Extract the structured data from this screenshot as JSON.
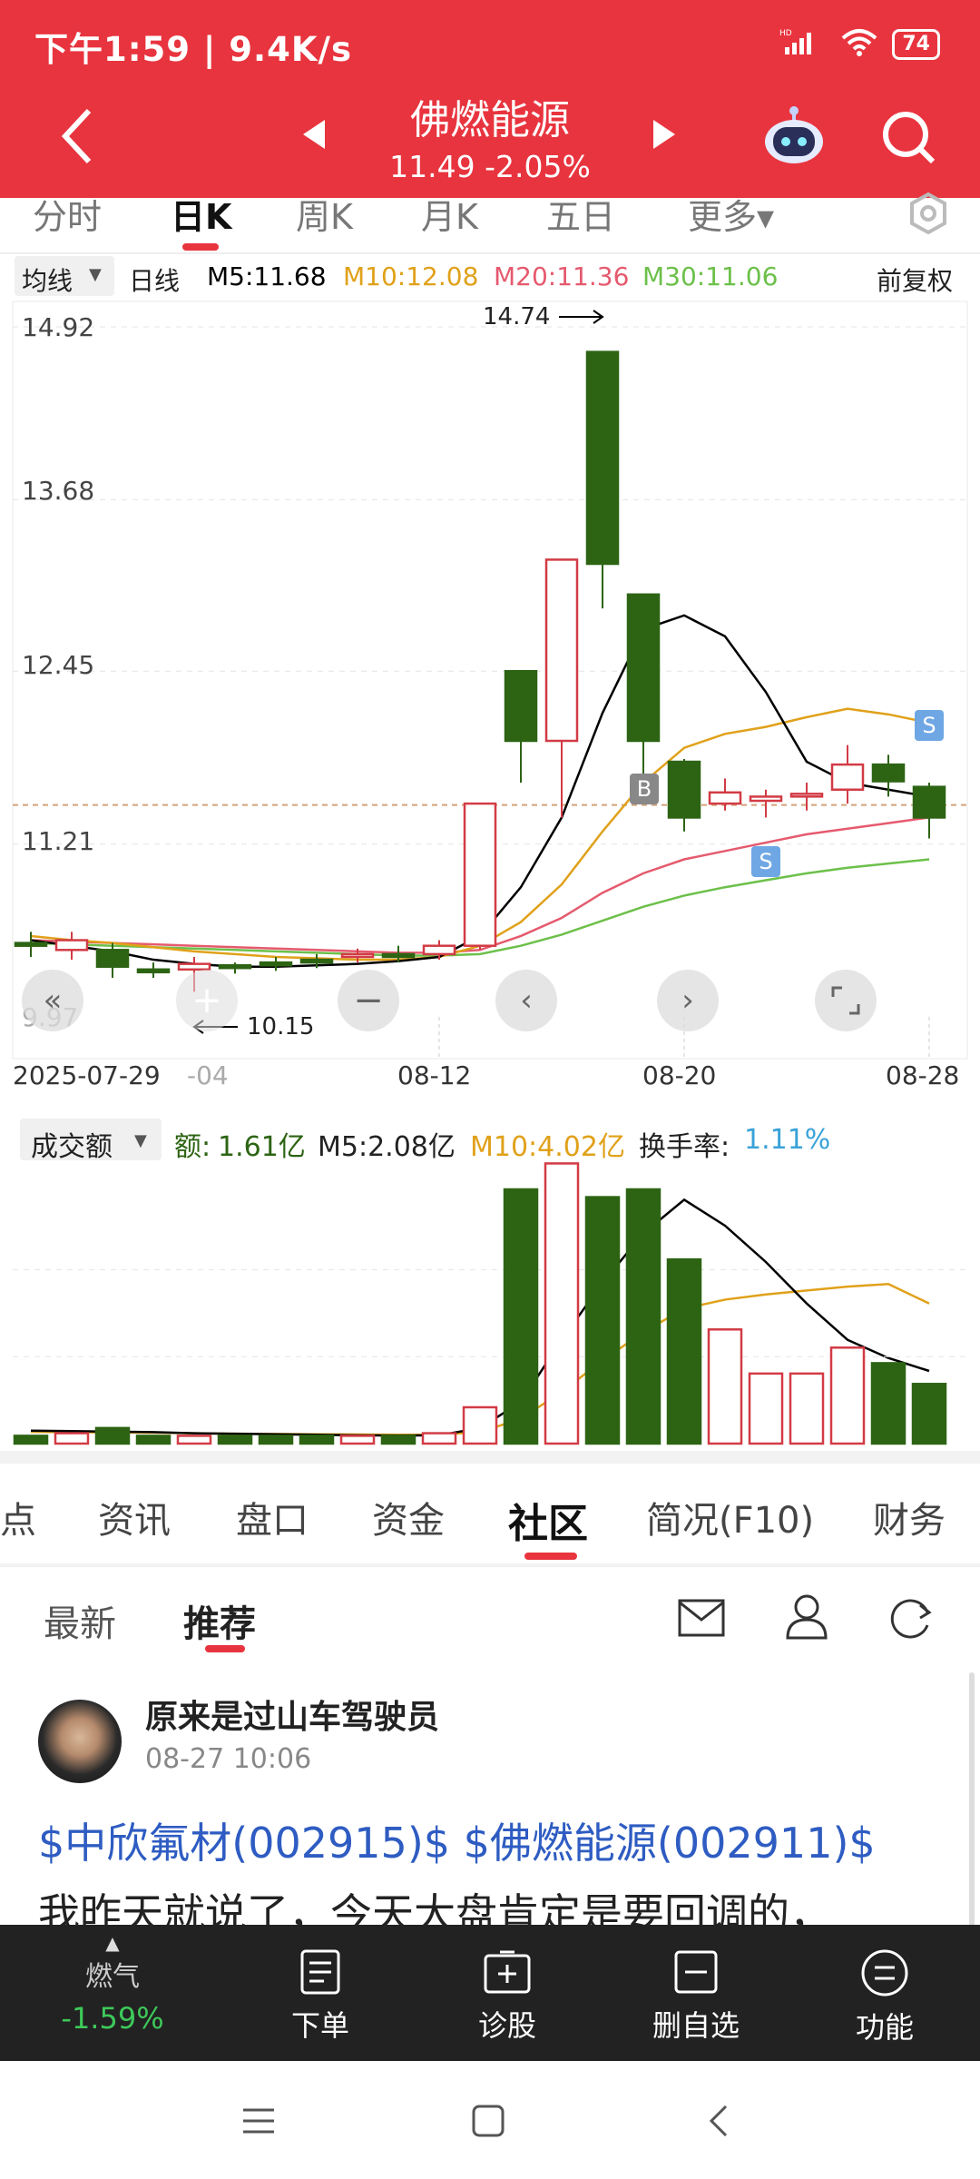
{
  "status": {
    "time_speed": "下午1:59 | 9.4K/s",
    "battery": "74",
    "net": "HD"
  },
  "header": {
    "title": "佛燃能源",
    "price_line": "11.49 -2.05%"
  },
  "period_tabs": [
    "分时",
    "日K",
    "周K",
    "月K",
    "五日",
    "更多▾"
  ],
  "ma_bar": {
    "selector": "均线",
    "kline": "日线",
    "m5": "M5:11.68",
    "m10": "M10:12.08",
    "m20": "M20:11.36",
    "m30": "M30:11.06",
    "fq": "前复权"
  },
  "price_axis": [
    "14.92",
    "13.68",
    "12.45",
    "11.21",
    "9.97"
  ],
  "date_axis": [
    "2025-07-29",
    "-04",
    "08-12",
    "08-20",
    "08-28"
  ],
  "markers": {
    "high": "14.74",
    "low": "10.15",
    "b": "B",
    "s1": "S",
    "s2": "S"
  },
  "vol_bar": {
    "selector": "成交额",
    "amount_label": "额:",
    "amount_value": "1.61亿",
    "m5": "M5:2.08亿",
    "m10": "M10:4.02亿",
    "turnover_label": "换手率:",
    "turnover_value": "1.11%"
  },
  "colors": {
    "up": "#d23b45",
    "down": "#2d6414",
    "accent": "#e8343e",
    "m5": "#000000",
    "m10": "#e0a11a",
    "m20": "#e55a6e",
    "m30": "#6cc04a"
  },
  "chart_data": {
    "type": "candlestick",
    "ylim": [
      9.97,
      14.92
    ],
    "candles": [
      {
        "o": 10.5,
        "c": 10.48,
        "h": 10.58,
        "l": 10.4,
        "dir": "down"
      },
      {
        "o": 10.45,
        "c": 10.52,
        "h": 10.58,
        "l": 10.38,
        "dir": "up"
      },
      {
        "o": 10.45,
        "c": 10.33,
        "h": 10.5,
        "l": 10.25,
        "dir": "down"
      },
      {
        "o": 10.3,
        "c": 10.31,
        "h": 10.36,
        "l": 10.25,
        "dir": "down"
      },
      {
        "o": 10.31,
        "c": 10.35,
        "h": 10.4,
        "l": 10.15,
        "dir": "up"
      },
      {
        "o": 10.34,
        "c": 10.33,
        "h": 10.36,
        "l": 10.28,
        "dir": "down"
      },
      {
        "o": 10.36,
        "c": 10.34,
        "h": 10.4,
        "l": 10.3,
        "dir": "down"
      },
      {
        "o": 10.38,
        "c": 10.36,
        "h": 10.42,
        "l": 10.32,
        "dir": "down"
      },
      {
        "o": 10.4,
        "c": 10.42,
        "h": 10.46,
        "l": 10.36,
        "dir": "up"
      },
      {
        "o": 10.42,
        "c": 10.4,
        "h": 10.48,
        "l": 10.36,
        "dir": "down"
      },
      {
        "o": 10.42,
        "c": 10.48,
        "h": 10.52,
        "l": 10.38,
        "dir": "up"
      },
      {
        "o": 10.48,
        "c": 11.5,
        "h": 11.5,
        "l": 10.45,
        "dir": "up"
      },
      {
        "o": 12.45,
        "c": 11.95,
        "h": 12.45,
        "l": 11.65,
        "dir": "down"
      },
      {
        "o": 11.95,
        "c": 13.25,
        "h": 13.25,
        "l": 11.4,
        "dir": "up"
      },
      {
        "o": 13.22,
        "c": 14.74,
        "h": 14.74,
        "l": 12.9,
        "dir": "down"
      },
      {
        "o": 13.0,
        "c": 11.95,
        "h": 13.0,
        "l": 11.7,
        "dir": "down"
      },
      {
        "o": 11.8,
        "c": 11.4,
        "h": 11.82,
        "l": 11.3,
        "dir": "down"
      },
      {
        "o": 11.5,
        "c": 11.58,
        "h": 11.68,
        "l": 11.45,
        "dir": "up"
      },
      {
        "o": 11.52,
        "c": 11.55,
        "h": 11.6,
        "l": 11.4,
        "dir": "up"
      },
      {
        "o": 11.56,
        "c": 11.57,
        "h": 11.65,
        "l": 11.45,
        "dir": "up"
      },
      {
        "o": 11.6,
        "c": 11.78,
        "h": 11.92,
        "l": 11.5,
        "dir": "up"
      },
      {
        "o": 11.78,
        "c": 11.66,
        "h": 11.85,
        "l": 11.55,
        "dir": "down"
      },
      {
        "o": 11.62,
        "c": 11.4,
        "h": 11.65,
        "l": 11.25,
        "dir": "down"
      }
    ],
    "ma5": [
      10.52,
      10.48,
      10.44,
      10.38,
      10.35,
      10.33,
      10.33,
      10.34,
      10.35,
      10.37,
      10.4,
      10.55,
      10.9,
      11.4,
      12.15,
      12.75,
      12.85,
      12.7,
      12.3,
      11.8,
      11.65,
      11.6,
      11.55
    ],
    "ma10": [
      10.55,
      10.52,
      10.5,
      10.47,
      10.44,
      10.42,
      10.4,
      10.39,
      10.38,
      10.38,
      10.4,
      10.48,
      10.65,
      10.92,
      11.3,
      11.65,
      11.9,
      12.0,
      12.05,
      12.12,
      12.18,
      12.14,
      12.08
    ],
    "ma20": [
      10.52,
      10.51,
      10.5,
      10.49,
      10.48,
      10.47,
      10.46,
      10.45,
      10.44,
      10.43,
      10.43,
      10.45,
      10.55,
      10.68,
      10.86,
      11.0,
      11.1,
      11.16,
      11.22,
      11.28,
      11.32,
      11.36,
      11.4
    ],
    "ma30": [
      10.5,
      10.49,
      10.48,
      10.47,
      10.46,
      10.45,
      10.44,
      10.43,
      10.42,
      10.41,
      10.41,
      10.42,
      10.48,
      10.56,
      10.66,
      10.76,
      10.84,
      10.9,
      10.95,
      11.0,
      11.04,
      11.07,
      11.1
    ],
    "volume": {
      "ylim": [
        0,
        10.5
      ],
      "values": [
        0.3,
        0.4,
        0.6,
        0.3,
        0.3,
        0.3,
        0.3,
        0.3,
        0.3,
        0.3,
        0.4,
        1.4,
        9.8,
        10.8,
        9.5,
        9.8,
        7.1,
        4.4,
        2.7,
        2.7,
        3.7,
        3.1,
        2.3
      ],
      "m5": [
        0.5,
        0.48,
        0.46,
        0.44,
        0.4,
        0.38,
        0.36,
        0.34,
        0.32,
        0.31,
        0.32,
        0.6,
        1.6,
        4.0,
        6.2,
        8.1,
        9.4,
        8.4,
        7.0,
        5.4,
        4.0,
        3.3,
        2.8
      ],
      "m10": [
        0.45,
        0.44,
        0.43,
        0.42,
        0.4,
        0.38,
        0.37,
        0.36,
        0.35,
        0.34,
        0.34,
        0.45,
        0.95,
        2.0,
        3.2,
        4.3,
        5.2,
        5.55,
        5.75,
        5.9,
        6.05,
        6.15,
        5.4
      ]
    }
  },
  "bottom_tabs": [
    "点",
    "资讯",
    "盘口",
    "资金",
    "社区",
    "简况(F10)",
    "财务"
  ],
  "sub_tabs": [
    "最新",
    "推荐"
  ],
  "post": {
    "author": "原来是过山车驾驶员",
    "time": "08-27 10:06",
    "tags": "$中欣氟材(002915)$ $佛燃能源(002911)$",
    "body": "我昨天就说了，今天大盘肯定是要回调的，"
  },
  "bottom_bar": {
    "sector_name": "燃气",
    "sector_change": "-1.59%",
    "items": [
      "下单",
      "诊股",
      "删自选",
      "功能"
    ]
  }
}
